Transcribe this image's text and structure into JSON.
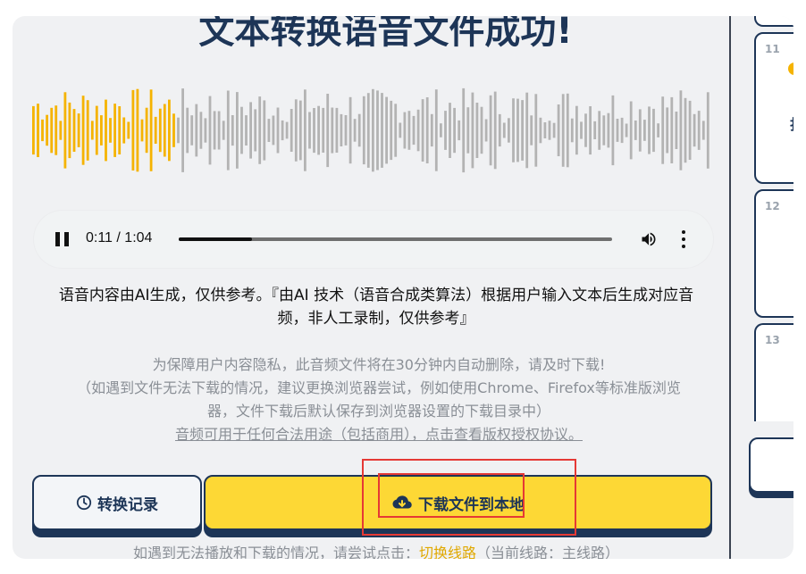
{
  "result": {
    "title": "文本转换语音文件成功!"
  },
  "player": {
    "time_display": "0:11 / 1:04",
    "progress_fraction": 0.17
  },
  "notice": {
    "line1": "语音内容由AI生成，仅供参考。『由AI 技术（语音合成类算法）根据用户输入文本后生成对应音",
    "line2": "频，非人工录制，仅供参考』"
  },
  "privacy": {
    "line1": "为保障用户内容隐私，此音频文件将在30分钟内自动删除，请及时下载!",
    "line2": "（如遇到文件无法下载的情况，建议更换浏览器尝试，例如使用Chrome、Firefox等标准版浏览",
    "line3": "器，文件下载后默认保存到浏览器设置的下载目录中）",
    "license_link": "音频可用于任何合法用途（包括商用），点击查看版权授权协议。"
  },
  "buttons": {
    "history_label": "转换记录",
    "download_label": "下载文件到本地"
  },
  "switch_line": {
    "prefix": "如遇到无法播放和下载的情况，请尝试点击：",
    "link": "切换线路",
    "suffix": "（当前线路：主线路）"
  },
  "sidebar": {
    "items": [
      {
        "number": "11",
        "char": "打"
      },
      {
        "number": "12"
      },
      {
        "number": "13"
      }
    ]
  },
  "colors": {
    "accent": "#fdd835",
    "navy": "#1d3557",
    "wave_played": "#f5b301",
    "wave_unplayed": "#b3b3b3",
    "highlight_box": "#e53935"
  },
  "icons": {
    "pause": "pause-icon",
    "volume": "volume-icon",
    "more": "more-vert-icon",
    "history": "clock-icon",
    "download": "cloud-download-icon"
  }
}
